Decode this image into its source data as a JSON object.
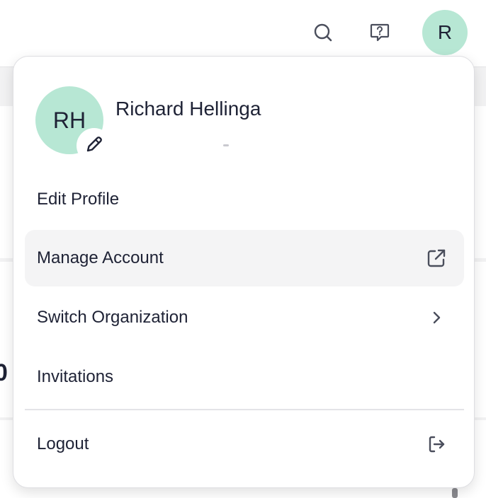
{
  "header": {
    "search_icon": "search-icon",
    "help_icon": "help-chat-icon",
    "avatar_initial": "R"
  },
  "background": {
    "partial_number": "0"
  },
  "profile_menu": {
    "avatar_initials": "RH",
    "name": "Richard Hellinga",
    "edit_avatar_icon": "pencil-icon",
    "items": [
      {
        "label": "Edit Profile",
        "icon": null
      },
      {
        "label": "Manage Account",
        "icon": "external-link-icon",
        "highlighted": true
      },
      {
        "label": "Switch Organization",
        "icon": "chevron-right-icon"
      },
      {
        "label": "Invitations",
        "icon": null
      },
      {
        "label": "Logout",
        "icon": "logout-icon"
      }
    ]
  },
  "colors": {
    "avatar_bg": "#b7e7d4",
    "text": "#1e2235",
    "hover_bg": "#f4f4f5",
    "icon": "#4a4e5c"
  }
}
